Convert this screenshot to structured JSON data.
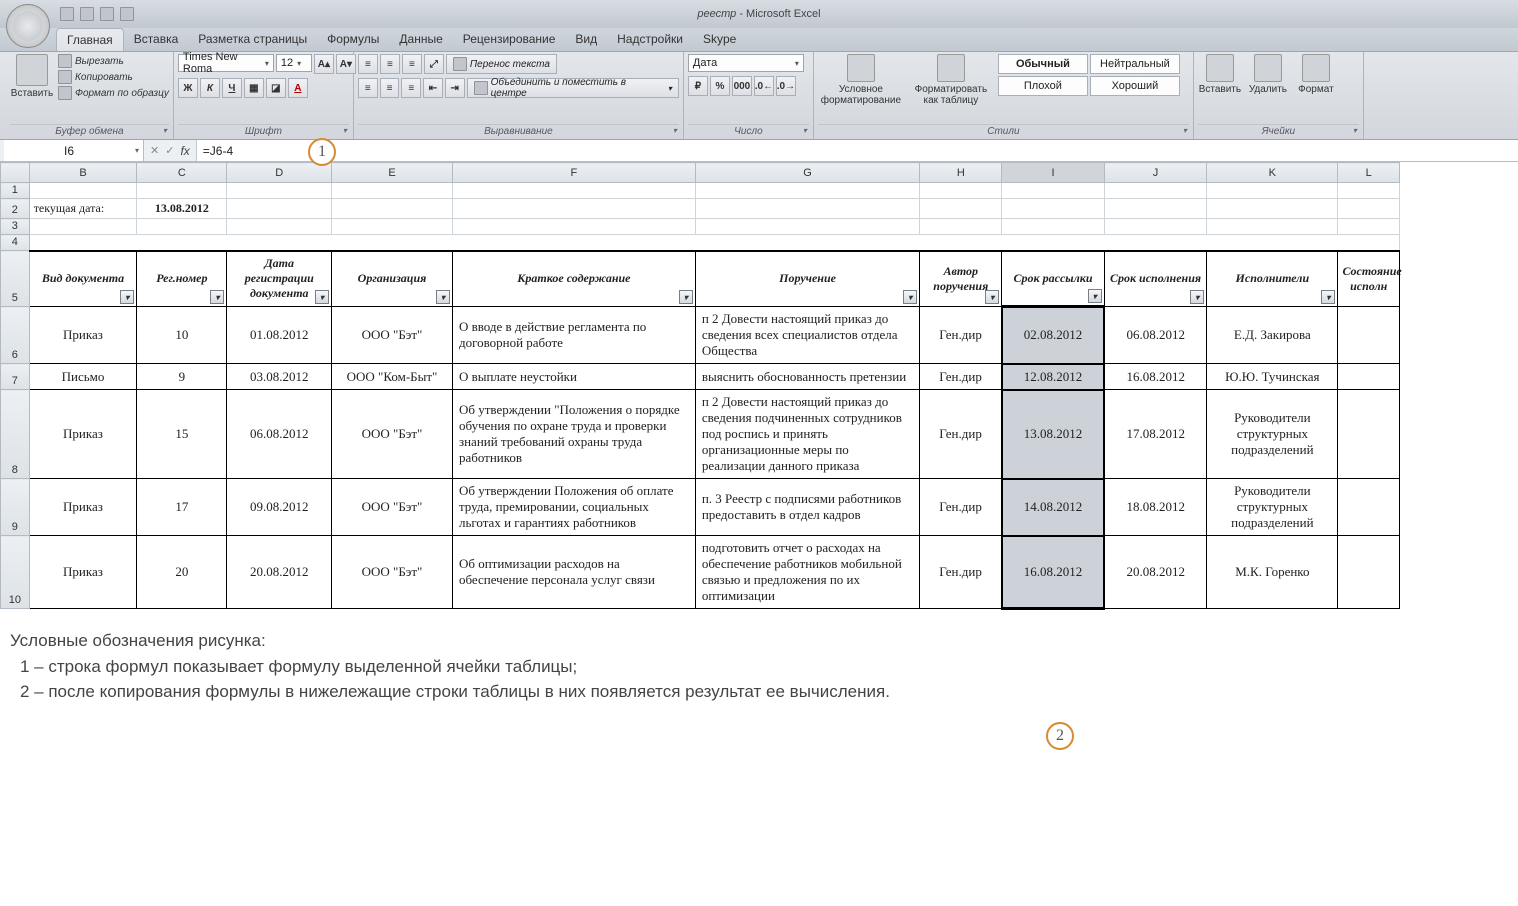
{
  "title": {
    "doc": "реестр",
    "app": " - Microsoft Excel"
  },
  "tabs": [
    "Главная",
    "Вставка",
    "Разметка страницы",
    "Формулы",
    "Данные",
    "Рецензирование",
    "Вид",
    "Надстройки",
    "Skype"
  ],
  "ribbon": {
    "clipboard": {
      "paste": "Вставить",
      "cut": "Вырезать",
      "copy": "Копировать",
      "format_painter": "Формат по образцу",
      "label": "Буфер обмена"
    },
    "font": {
      "name": "Times New Roma",
      "size": "12",
      "bold": "Ж",
      "italic": "К",
      "underline": "Ч",
      "label": "Шрифт"
    },
    "alignment": {
      "wrap": "Перенос текста",
      "merge": "Объединить и поместить в центре",
      "label": "Выравнивание"
    },
    "number": {
      "format": "Дата",
      "label": "Число"
    },
    "styles": {
      "cond": "Условное форматирование",
      "table": "Форматировать как таблицу",
      "normal": "Обычный",
      "neutral": "Нейтральный",
      "bad": "Плохой",
      "good": "Хороший",
      "label": "Стили"
    },
    "cells": {
      "insert": "Вставить",
      "delete": "Удалить",
      "format": "Формат",
      "label": "Ячейки"
    }
  },
  "formula_bar": {
    "ref": "I6",
    "formula": "=J6-4"
  },
  "columns": [
    "B",
    "C",
    "D",
    "E",
    "F",
    "G",
    "H",
    "I",
    "J",
    "K",
    "L"
  ],
  "row_nums": [
    "1",
    "2",
    "3",
    "4",
    "5",
    "6",
    "7",
    "8",
    "9",
    "10"
  ],
  "top": {
    "label": "текущая дата:",
    "date": "13.08.2012"
  },
  "headers": {
    "b": "Вид документа",
    "c": "Рег.номер",
    "d": "Дата регистрации документа",
    "e": "Организация",
    "f": "Краткое содержание",
    "g": "Поручение",
    "h": "Автор поручения",
    "i": "Срок рассылки",
    "j": "Срок исполнения",
    "k": "Исполнители",
    "l": "Состояние исполн"
  },
  "rows": [
    {
      "b": "Приказ",
      "c": "10",
      "d": "01.08.2012",
      "e": "ООО \"Бэт\"",
      "f": "О вводе в действие регламента по договорной работе",
      "g": "п 2 Довести настоящий приказ до сведения всех специалистов отдела Общества",
      "h": "Ген.дир",
      "i": "02.08.2012",
      "j": "06.08.2012",
      "k": "Е.Д. Закирова"
    },
    {
      "b": "Письмо",
      "c": "9",
      "d": "03.08.2012",
      "e": "ООО \"Ком-Быт\"",
      "f": "О выплате неустойки",
      "g": "выяснить обоснованность претензии",
      "h": "Ген.дир",
      "i": "12.08.2012",
      "j": "16.08.2012",
      "k": "Ю.Ю. Тучинская"
    },
    {
      "b": "Приказ",
      "c": "15",
      "d": "06.08.2012",
      "e": "ООО \"Бэт\"",
      "f": "Об утверждении \"Положения о порядке обучения по охране труда и проверки знаний требований охраны труда работников",
      "g": "п 2 Довести настоящий приказ до сведения подчиненных сотрудников под роспись и принять организационные меры по реализации данного приказа",
      "h": "Ген.дир",
      "i": "13.08.2012",
      "j": "17.08.2012",
      "k": "Руководители структурных подразделений"
    },
    {
      "b": "Приказ",
      "c": "17",
      "d": "09.08.2012",
      "e": "ООО \"Бэт\"",
      "f": "Об утверждении Положения об оплате труда, премировании, социальных льготах и гарантиях работников",
      "g": "п. 3 Реестр с подписями работников предоставить в отдел кадров",
      "h": "Ген.дир",
      "i": "14.08.2012",
      "j": "18.08.2012",
      "k": "Руководители структурных подразделений"
    },
    {
      "b": "Приказ",
      "c": "20",
      "d": "20.08.2012",
      "e": "ООО \"Бэт\"",
      "f": "Об оптимизации расходов на обеспечение персонала услуг связи",
      "g": "подготовить отчет о расходах на обеспечение работников мобильной связью и предложения по их оптимизации",
      "h": "Ген.дир",
      "i": "16.08.2012",
      "j": "20.08.2012",
      "k": "М.К. Горенко"
    }
  ],
  "callouts": {
    "c1": "1",
    "c2": "2"
  },
  "legend": {
    "title": "Условные обозначения рисунка:",
    "l1": "1 –  строка формул показывает формулу выделенной ячейки таблицы;",
    "l2": "2 –  после копирования формулы в нижележащие строки таблицы в них появляется результат ее вычисления."
  }
}
